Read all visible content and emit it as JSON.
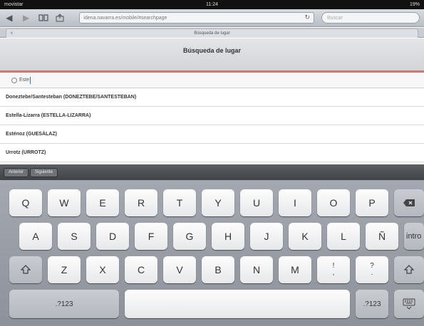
{
  "status_bar": {
    "carrier": "movistar",
    "time": "11:24",
    "battery": "19%"
  },
  "browser": {
    "url": "idena.navarra.es/mobile/#searchpage",
    "search_placeholder": "Buscar",
    "tab_title": "Búsqueda de lugar",
    "icons": [
      "back-icon",
      "forward-icon",
      "bookmarks-icon",
      "share-icon",
      "reload-icon"
    ]
  },
  "page": {
    "title": "Búsqueda de lugar",
    "search_value": "Este",
    "results": [
      "Doneztebe/Santesteban (DONEZTEBE/SANTESTEBAN)",
      "Estella-Lizarra (ESTELLA-LIZARRA)",
      "Esténoz (GUESÁLAZ)",
      "Urrotz (URROTZ)"
    ]
  },
  "keyboard": {
    "accessory": {
      "prev": "Anterior",
      "next": "Siguiente"
    },
    "row1": [
      "Q",
      "W",
      "E",
      "R",
      "T",
      "Y",
      "U",
      "I",
      "O",
      "P"
    ],
    "row2": [
      "A",
      "S",
      "D",
      "F",
      "G",
      "H",
      "J",
      "K",
      "L",
      "Ñ"
    ],
    "row3": [
      "Z",
      "X",
      "C",
      "V",
      "B",
      "N",
      "M"
    ],
    "enter_label": "intro",
    "numbers_label": ".?123",
    "punct1_top": "!",
    "punct1_bottom": ",",
    "punct2_top": "?",
    "punct2_bottom": "."
  }
}
